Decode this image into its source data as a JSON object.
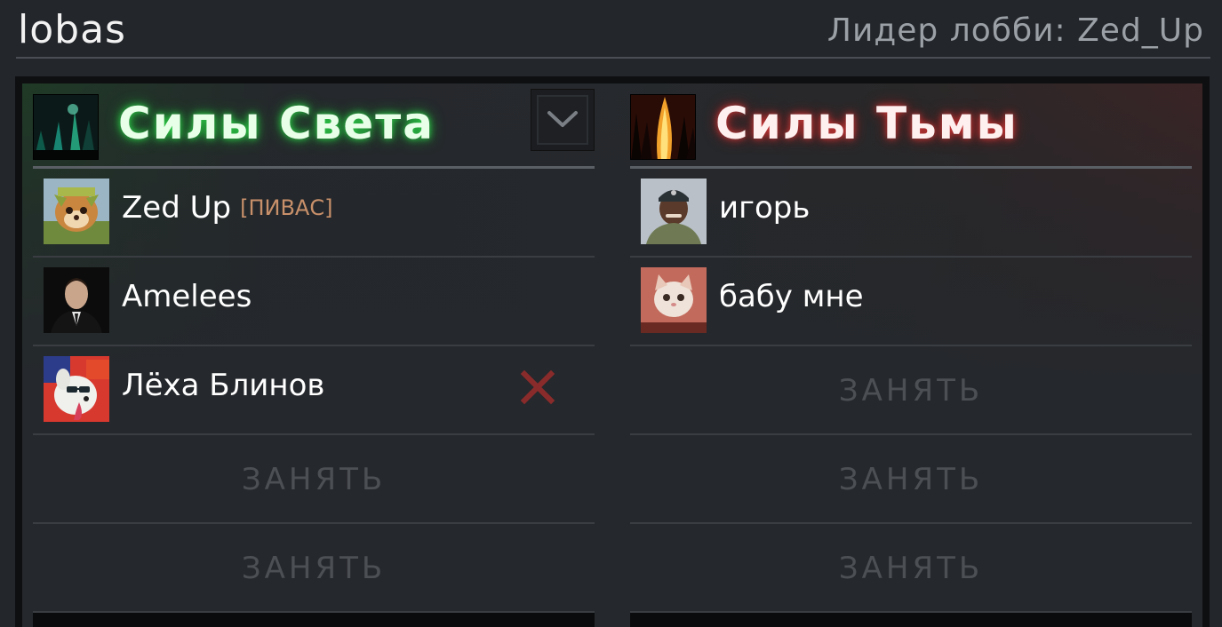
{
  "lobby": {
    "name": "lobas",
    "leader_text": "Лидер лобби: Zed_Up"
  },
  "radiant": {
    "name": "Силы Света",
    "icon": "radiant-forest-icon",
    "color": "#2fd34a",
    "slots": [
      {
        "player": "Zed Up",
        "tag": "[ПИВАС]",
        "avatar": "fox-avatar"
      },
      {
        "player": "Amelees",
        "avatar": "man-avatar"
      },
      {
        "player": "Лёха Блинов",
        "avatar": "dog-avatar",
        "kickable": true
      },
      {
        "empty": "ЗАНЯТЬ"
      },
      {
        "empty": "ЗАНЯТЬ"
      }
    ]
  },
  "dire": {
    "name": "Силы Тьмы",
    "icon": "dire-fire-icon",
    "color": "#d23a3a",
    "slots": [
      {
        "player": "игорь",
        "avatar": "man-cap-avatar"
      },
      {
        "player": "бабу мне",
        "avatar": "kitten-avatar"
      },
      {
        "empty": "ЗАНЯТЬ"
      },
      {
        "empty": "ЗАНЯТЬ"
      },
      {
        "empty": "ЗАНЯТЬ"
      }
    ]
  }
}
